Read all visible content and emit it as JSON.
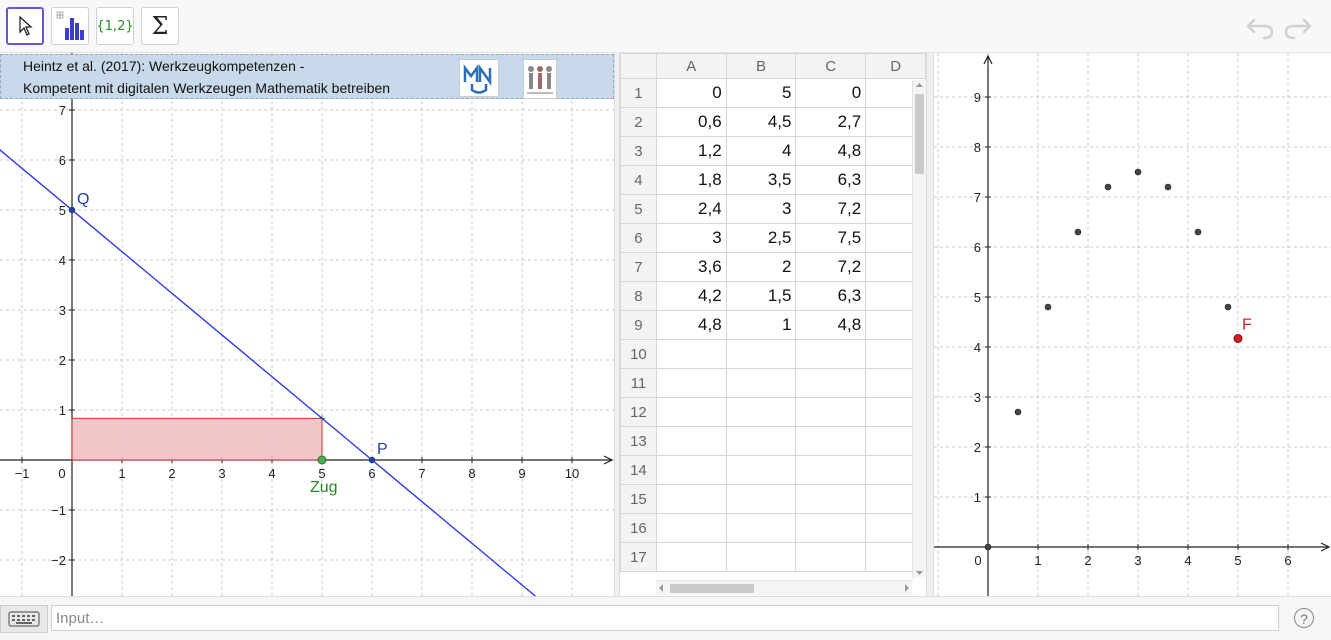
{
  "toolbar": {
    "tools": [
      {
        "name": "move",
        "icon": "cursor-arrow-icon",
        "active": true
      },
      {
        "name": "statistics",
        "icon": "bar-chart-icon"
      },
      {
        "name": "list",
        "label": "{1,2}"
      },
      {
        "name": "sum",
        "label": "Σ"
      }
    ],
    "undo_icon": "undo-icon",
    "redo_icon": "redo-icon"
  },
  "graphics1": {
    "citation_line1": "Heintz et al. (2017): Werkzeugkompetenzen -",
    "citation_line2": "Kompetent mit digitalen Werkzeugen Mathematik betreiben",
    "x_ticks": [
      "−1",
      "0",
      "1",
      "2",
      "3",
      "4",
      "5",
      "6",
      "7",
      "8",
      "9",
      "10"
    ],
    "y_ticks": [
      "7",
      "6",
      "5",
      "4",
      "3",
      "2",
      "1",
      "−1",
      "−2"
    ],
    "point_Q": {
      "label": "Q",
      "x": 0,
      "y": 5
    },
    "point_P": {
      "label": "P",
      "x": 6,
      "y": 0
    },
    "point_Zug": {
      "label": "Zug",
      "x": 5,
      "y": 0
    },
    "rectangle": {
      "x1": 0,
      "x2": 5,
      "y1": 0,
      "y2": 0.833
    },
    "colors": {
      "line": "#2030e0",
      "point": "#1f3fa0",
      "zug": "#228b22",
      "rect_fill": "#f2c0c4",
      "rect_stroke": "#cc3333"
    }
  },
  "spreadsheet": {
    "columns": [
      "A",
      "B",
      "C",
      "D"
    ],
    "rows": [
      {
        "n": "1",
        "a": "0",
        "b": "5",
        "c": "0"
      },
      {
        "n": "2",
        "a": "0,6",
        "b": "4,5",
        "c": "2,7"
      },
      {
        "n": "3",
        "a": "1,2",
        "b": "4",
        "c": "4,8"
      },
      {
        "n": "4",
        "a": "1,8",
        "b": "3,5",
        "c": "6,3"
      },
      {
        "n": "5",
        "a": "2,4",
        "b": "3",
        "c": "7,2"
      },
      {
        "n": "6",
        "a": "3",
        "b": "2,5",
        "c": "7,5"
      },
      {
        "n": "7",
        "a": "3,6",
        "b": "2",
        "c": "7,2"
      },
      {
        "n": "8",
        "a": "4,2",
        "b": "1,5",
        "c": "6,3"
      },
      {
        "n": "9",
        "a": "4,8",
        "b": "1",
        "c": "4,8"
      },
      {
        "n": "10",
        "a": "",
        "b": "",
        "c": ""
      },
      {
        "n": "11",
        "a": "",
        "b": "",
        "c": ""
      },
      {
        "n": "12",
        "a": "",
        "b": "",
        "c": ""
      },
      {
        "n": "13",
        "a": "",
        "b": "",
        "c": ""
      },
      {
        "n": "14",
        "a": "",
        "b": "",
        "c": ""
      },
      {
        "n": "15",
        "a": "",
        "b": "",
        "c": ""
      },
      {
        "n": "16",
        "a": "",
        "b": "",
        "c": ""
      },
      {
        "n": "17",
        "a": "",
        "b": "",
        "c": ""
      }
    ]
  },
  "graphics2": {
    "x_ticks": [
      "0",
      "1",
      "2",
      "3",
      "4",
      "5",
      "6"
    ],
    "y_ticks": [
      "9",
      "8",
      "7",
      "6",
      "5",
      "4",
      "3",
      "2",
      "1"
    ],
    "points": [
      {
        "x": 0,
        "y": 0
      },
      {
        "x": 0.6,
        "y": 2.7
      },
      {
        "x": 1.2,
        "y": 4.8
      },
      {
        "x": 1.8,
        "y": 6.3
      },
      {
        "x": 2.4,
        "y": 7.2
      },
      {
        "x": 3,
        "y": 7.5
      },
      {
        "x": 3.6,
        "y": 7.2
      },
      {
        "x": 4.2,
        "y": 6.3
      },
      {
        "x": 4.8,
        "y": 4.8
      }
    ],
    "point_F": {
      "label": "F",
      "x": 5,
      "y": 4.17
    },
    "colors": {
      "point": "#444444",
      "F": "#d32020"
    }
  },
  "input_bar": {
    "placeholder": "Input…",
    "keyboard_icon": "keyboard-icon",
    "help_label": "?"
  }
}
